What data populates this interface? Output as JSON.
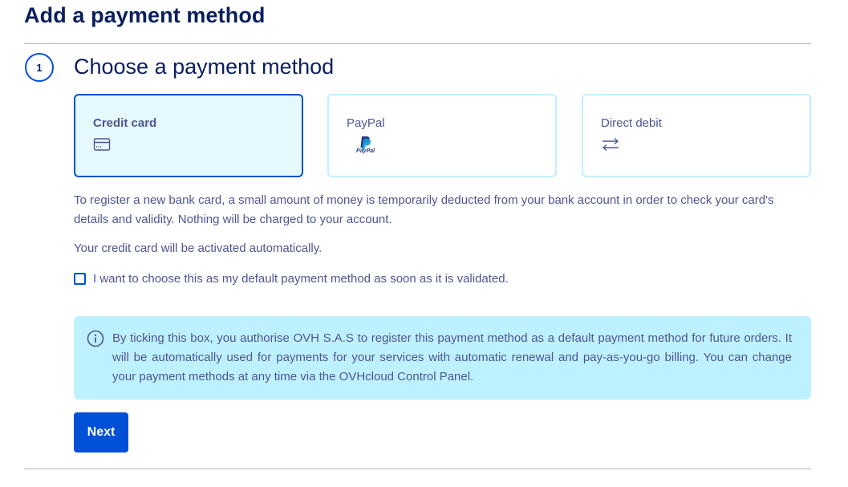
{
  "page": {
    "title": "Add a payment method"
  },
  "step": {
    "number": "1",
    "title": "Choose a payment method"
  },
  "options": [
    {
      "label": "Credit card",
      "icon": "credit-card-icon",
      "selected": true
    },
    {
      "label": "PayPal",
      "icon": "paypal-logo-icon",
      "logo_text": "PayPal",
      "selected": false
    },
    {
      "label": "Direct debit",
      "icon": "transfer-arrows-icon",
      "selected": false
    }
  ],
  "description": {
    "line1": "To register a new bank card, a small amount of money is temporarily deducted from your bank account in order to check your card's details and validity. Nothing will be charged to your account.",
    "line2": "Your credit card will be activated automatically."
  },
  "default_checkbox": {
    "label": "I want to choose this as my default payment method as soon as it is validated.",
    "checked": false
  },
  "info": {
    "icon": "info-icon",
    "text": "By ticking this box, you authorise OVH S.A.S to register this payment method as a default payment method for future orders. It will be automatically used for payments for your services with automatic renewal and pay-as-you-go billing. You can change your payment methods at any time via the OVHcloud Control Panel."
  },
  "actions": {
    "next_label": "Next"
  },
  "colors": {
    "primary": "#0050d7",
    "title": "#0a1f5c",
    "text": "#4d5592",
    "selected_bg": "#e5f9ff",
    "info_bg": "#bef1ff"
  }
}
